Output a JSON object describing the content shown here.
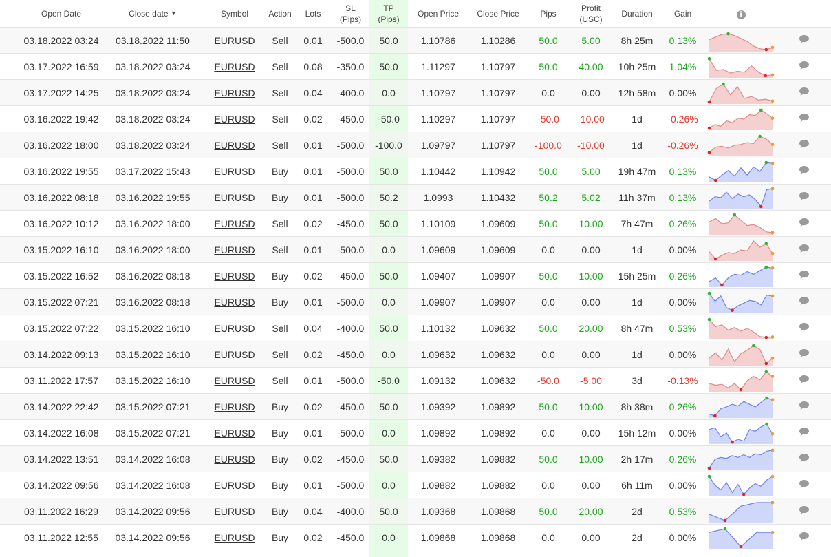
{
  "headers": {
    "open_date": "Open Date",
    "close_date": "Close date",
    "sort_indicator": "▼",
    "symbol": "Symbol",
    "action": "Action",
    "lots": "Lots",
    "sl_line1": "SL",
    "sl_line2": "(Pips)",
    "tp_line1": "TP",
    "tp_line2": "(Pips)",
    "open_price": "Open Price",
    "close_price": "Close Price",
    "pips": "Pips",
    "profit_line1": "Profit",
    "profit_line2": "(USC)",
    "duration": "Duration",
    "gain": "Gain",
    "info_icon": "i"
  },
  "colors": {
    "positive": "#1aa51a",
    "negative": "#e0382c",
    "tp_band": "#e6fce6",
    "sell_fill": "#f4d0d0",
    "sell_line": "#e08a8a",
    "buy_fill": "#cfd8fb",
    "buy_line": "#6f82ee",
    "marker_max": "#2db52d",
    "marker_min": "#e52222",
    "marker_end": "#f39a2b",
    "chat_icon": "#9a9a9a"
  },
  "trades": [
    {
      "open": "03.18.2022 03:24",
      "close": "03.18.2022 11:50",
      "symbol": "EURUSD",
      "action": "Sell",
      "lots": "0.01",
      "sl": "-500.0",
      "tp": "50.0",
      "open_price": "1.10786",
      "close_price": "1.10286",
      "pips": "50.0",
      "profit": "5.00",
      "duration": "8h 25m",
      "gain": "0.13%",
      "sign": "pos",
      "spark": [
        0.55,
        0.7,
        0.85,
        0.88,
        0.78,
        0.62,
        0.45,
        0.2,
        0.05,
        0.0,
        0.12
      ],
      "mx": 3,
      "mn": 9
    },
    {
      "open": "03.17.2022 16:59",
      "close": "03.18.2022 03:24",
      "symbol": "EURUSD",
      "action": "Sell",
      "lots": "0.08",
      "sl": "-350.0",
      "tp": "50.0",
      "open_price": "1.11297",
      "close_price": "1.10797",
      "pips": "50.0",
      "profit": "40.00",
      "duration": "10h 25m",
      "gain": "1.04%",
      "sign": "pos",
      "spark": [
        0.95,
        0.3,
        0.35,
        0.15,
        0.25,
        0.2,
        0.55,
        0.2,
        0.0,
        0.05
      ],
      "mx": 0,
      "mn": 8
    },
    {
      "open": "03.17.2022 14:25",
      "close": "03.18.2022 03:24",
      "symbol": "EURUSD",
      "action": "Sell",
      "lots": "0.04",
      "sl": "-400.0",
      "tp": "0.0",
      "open_price": "1.10797",
      "close_price": "1.10797",
      "pips": "0.0",
      "profit": "0.00",
      "duration": "12h 58m",
      "gain": "0.00%",
      "sign": "neu",
      "spark": [
        0.0,
        0.75,
        1.0,
        0.4,
        0.85,
        0.2,
        0.3,
        0.1,
        0.15,
        0.05
      ],
      "mx": 2,
      "mn": 0
    },
    {
      "open": "03.16.2022 19:42",
      "close": "03.18.2022 03:24",
      "symbol": "EURUSD",
      "action": "Sell",
      "lots": "0.02",
      "sl": "-450.0",
      "tp": "-50.0",
      "open_price": "1.10297",
      "close_price": "1.10797",
      "pips": "-50.0",
      "profit": "-10.00",
      "duration": "1d",
      "gain": "-0.26%",
      "sign": "neg",
      "spark": [
        0.0,
        0.2,
        0.1,
        0.4,
        0.3,
        0.55,
        0.5,
        0.75,
        0.7,
        1.0,
        0.8,
        0.55
      ],
      "mx": 9,
      "mn": 0
    },
    {
      "open": "03.16.2022 18:00",
      "close": "03.18.2022 03:24",
      "symbol": "EURUSD",
      "action": "Sell",
      "lots": "0.01",
      "sl": "-500.0",
      "tp": "-100.0",
      "open_price": "1.09797",
      "close_price": "1.10797",
      "pips": "-100.0",
      "profit": "-10.00",
      "duration": "1d",
      "gain": "-0.26%",
      "sign": "neg",
      "spark": [
        0.1,
        0.4,
        0.45,
        0.35,
        0.5,
        0.55,
        0.65,
        0.6,
        1.0,
        0.85,
        0.55
      ],
      "mx": 8,
      "mn": 0
    },
    {
      "open": "03.16.2022 19:55",
      "close": "03.17.2022 15:43",
      "symbol": "EURUSD",
      "action": "Buy",
      "lots": "0.01",
      "sl": "-500.0",
      "tp": "50.0",
      "open_price": "1.10442",
      "close_price": "1.10942",
      "pips": "50.0",
      "profit": "5.00",
      "duration": "19h 47m",
      "gain": "0.13%",
      "sign": "pos",
      "spark": [
        0.2,
        0.0,
        0.3,
        0.55,
        0.25,
        0.7,
        0.3,
        0.75,
        0.5,
        1.0,
        0.95
      ],
      "mx": 9,
      "mn": 1
    },
    {
      "open": "03.16.2022 08:18",
      "close": "03.16.2022 19:55",
      "symbol": "EURUSD",
      "action": "Buy",
      "lots": "0.01",
      "sl": "-500.0",
      "tp": "50.2",
      "open_price": "1.0993",
      "close_price": "1.10432",
      "pips": "50.2",
      "profit": "5.02",
      "duration": "11h 37m",
      "gain": "0.13%",
      "sign": "pos",
      "spark": [
        0.3,
        0.55,
        0.5,
        0.8,
        0.45,
        0.7,
        0.55,
        0.65,
        0.4,
        0.0,
        0.95,
        1.0
      ],
      "mx": 11,
      "mn": 9
    },
    {
      "open": "03.16.2022 10:12",
      "close": "03.16.2022 18:00",
      "symbol": "EURUSD",
      "action": "Sell",
      "lots": "0.02",
      "sl": "-450.0",
      "tp": "50.0",
      "open_price": "1.10109",
      "close_price": "1.09609",
      "pips": "50.0",
      "profit": "10.00",
      "duration": "7h 47m",
      "gain": "0.26%",
      "sign": "pos",
      "spark": [
        0.6,
        0.8,
        0.5,
        0.55,
        1.0,
        0.7,
        0.4,
        0.45,
        0.3,
        0.05,
        0.0
      ],
      "mx": 4,
      "mn": 10
    },
    {
      "open": "03.15.2022 16:10",
      "close": "03.16.2022 18:00",
      "symbol": "EURUSD",
      "action": "Sell",
      "lots": "0.01",
      "sl": "-500.0",
      "tp": "0.0",
      "open_price": "1.09609",
      "close_price": "1.09609",
      "pips": "0.0",
      "profit": "0.00",
      "duration": "1d",
      "gain": "0.00%",
      "sign": "neu",
      "spark": [
        0.4,
        0.0,
        0.2,
        0.35,
        0.3,
        0.5,
        0.45,
        1.0,
        0.65,
        0.85,
        0.3
      ],
      "mx": 9,
      "mn": 1
    },
    {
      "open": "03.15.2022 16:52",
      "close": "03.16.2022 08:18",
      "symbol": "EURUSD",
      "action": "Buy",
      "lots": "0.02",
      "sl": "-450.0",
      "tp": "50.0",
      "open_price": "1.09407",
      "close_price": "1.09907",
      "pips": "50.0",
      "profit": "10.00",
      "duration": "15h 25m",
      "gain": "0.26%",
      "sign": "pos",
      "spark": [
        0.2,
        0.4,
        0.0,
        0.4,
        0.6,
        0.55,
        0.75,
        0.6,
        0.8,
        1.0,
        0.95
      ],
      "mx": 9,
      "mn": 2
    },
    {
      "open": "03.15.2022 07:21",
      "close": "03.16.2022 08:18",
      "symbol": "EURUSD",
      "action": "Buy",
      "lots": "0.01",
      "sl": "-500.0",
      "tp": "0.0",
      "open_price": "1.09907",
      "close_price": "1.09907",
      "pips": "0.0",
      "profit": "0.00",
      "duration": "1d",
      "gain": "0.00%",
      "sign": "neu",
      "spark": [
        1.0,
        0.55,
        0.85,
        0.2,
        0.05,
        0.3,
        0.45,
        0.6,
        0.55,
        0.35,
        0.9,
        0.85
      ],
      "mx": 0,
      "mn": 4
    },
    {
      "open": "03.15.2022 07:22",
      "close": "03.15.2022 16:10",
      "symbol": "EURUSD",
      "action": "Sell",
      "lots": "0.04",
      "sl": "-400.0",
      "tp": "50.0",
      "open_price": "1.10132",
      "close_price": "1.09632",
      "pips": "50.0",
      "profit": "20.00",
      "duration": "8h 47m",
      "gain": "0.53%",
      "sign": "pos",
      "spark": [
        1.0,
        0.6,
        0.7,
        0.4,
        0.55,
        0.35,
        0.5,
        0.3,
        0.05,
        0.0,
        0.02
      ],
      "mx": 0,
      "mn": 9
    },
    {
      "open": "03.14.2022 09:13",
      "close": "03.15.2022 16:10",
      "symbol": "EURUSD",
      "action": "Sell",
      "lots": "0.02",
      "sl": "-450.0",
      "tp": "0.0",
      "open_price": "1.09632",
      "close_price": "1.09632",
      "pips": "0.0",
      "profit": "0.00",
      "duration": "1d",
      "gain": "0.00%",
      "sign": "neu",
      "spark": [
        0.3,
        0.6,
        0.2,
        0.8,
        0.1,
        0.55,
        0.75,
        1.0,
        0.8,
        0.0,
        0.3
      ],
      "mx": 7,
      "mn": 9
    },
    {
      "open": "03.11.2022 17:57",
      "close": "03.15.2022 16:10",
      "symbol": "EURUSD",
      "action": "Sell",
      "lots": "0.01",
      "sl": "-500.0",
      "tp": "-50.0",
      "open_price": "1.09132",
      "close_price": "1.09632",
      "pips": "-50.0",
      "profit": "-5.00",
      "duration": "3d",
      "gain": "-0.13%",
      "sign": "neg",
      "spark": [
        0.35,
        0.25,
        0.3,
        0.1,
        0.35,
        0.0,
        0.5,
        0.75,
        0.55,
        1.0,
        0.75
      ],
      "mx": 9,
      "mn": 5
    },
    {
      "open": "03.14.2022 22:42",
      "close": "03.15.2022 07:21",
      "symbol": "EURUSD",
      "action": "Buy",
      "lots": "0.02",
      "sl": "-450.0",
      "tp": "50.0",
      "open_price": "1.09392",
      "close_price": "1.09892",
      "pips": "50.0",
      "profit": "10.00",
      "duration": "8h 38m",
      "gain": "0.26%",
      "sign": "pos",
      "spark": [
        0.1,
        0.0,
        0.4,
        0.5,
        0.65,
        0.55,
        0.8,
        0.65,
        0.5,
        0.75,
        1.0,
        0.9
      ],
      "mx": 10,
      "mn": 1
    },
    {
      "open": "03.14.2022 16:08",
      "close": "03.15.2022 07:21",
      "symbol": "EURUSD",
      "action": "Buy",
      "lots": "0.01",
      "sl": "-500.0",
      "tp": "0.0",
      "open_price": "1.09892",
      "close_price": "1.09892",
      "pips": "0.0",
      "profit": "0.00",
      "duration": "15h 12m",
      "gain": "0.00%",
      "sign": "neu",
      "spark": [
        0.7,
        0.8,
        0.3,
        0.5,
        0.0,
        0.15,
        0.05,
        0.7,
        0.6,
        0.85,
        1.0,
        0.45
      ],
      "mx": 10,
      "mn": 4
    },
    {
      "open": "03.14.2022 13:51",
      "close": "03.14.2022 16:08",
      "symbol": "EURUSD",
      "action": "Buy",
      "lots": "0.02",
      "sl": "-450.0",
      "tp": "50.0",
      "open_price": "1.09382",
      "close_price": "1.09882",
      "pips": "50.0",
      "profit": "10.00",
      "duration": "2h 17m",
      "gain": "0.26%",
      "sign": "pos",
      "spark": [
        0.0,
        0.5,
        0.6,
        0.55,
        0.7,
        0.6,
        0.75,
        0.6,
        0.8,
        0.75,
        0.95,
        1.0
      ],
      "mx": 11,
      "mn": 0
    },
    {
      "open": "03.14.2022 09:56",
      "close": "03.14.2022 16:08",
      "symbol": "EURUSD",
      "action": "Buy",
      "lots": "0.01",
      "sl": "-500.0",
      "tp": "0.0",
      "open_price": "1.09882",
      "close_price": "1.09882",
      "pips": "0.0",
      "profit": "0.00",
      "duration": "6h 11m",
      "gain": "0.00%",
      "sign": "neu",
      "spark": [
        1.0,
        0.5,
        0.25,
        0.65,
        0.1,
        0.55,
        0.0,
        0.35,
        0.6,
        0.45,
        0.8,
        1.0
      ],
      "mx": 0,
      "mn": 6
    },
    {
      "open": "03.11.2022 16:29",
      "close": "03.14.2022 09:56",
      "symbol": "EURUSD",
      "action": "Buy",
      "lots": "0.04",
      "sl": "-400.0",
      "tp": "50.0",
      "open_price": "1.09368",
      "close_price": "1.09868",
      "pips": "50.0",
      "profit": "20.00",
      "duration": "2d",
      "gain": "0.53%",
      "sign": "pos",
      "spark": [
        0.35,
        0.0,
        0.8,
        1.0,
        1.0
      ],
      "mx": 4,
      "mn": 1
    },
    {
      "open": "03.11.2022 12:55",
      "close": "03.14.2022 09:56",
      "symbol": "EURUSD",
      "action": "Buy",
      "lots": "0.02",
      "sl": "-450.0",
      "tp": "0.0",
      "open_price": "1.09868",
      "close_price": "1.09868",
      "pips": "0.0",
      "profit": "0.00",
      "duration": "2d",
      "gain": "0.00%",
      "sign": "neu",
      "spark": [
        0.8,
        1.0,
        0.0,
        0.8,
        0.8
      ],
      "mx": 1,
      "mn": 2
    }
  ]
}
